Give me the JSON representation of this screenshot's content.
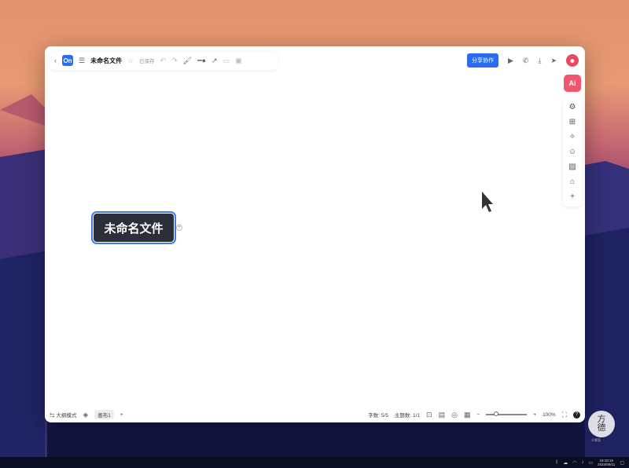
{
  "app": {
    "logo_text": "On",
    "doc_title": "未命名文件",
    "save_status": "已保存"
  },
  "toolbar": {
    "share_label": "分享协作"
  },
  "side_panel": {
    "ai_label": "Ai"
  },
  "canvas": {
    "root_node_text": "未命名文件",
    "add_child": "+"
  },
  "statusbar": {
    "outline_mode": "大纲模式",
    "layer_tab": "画布1",
    "add_layer": "+",
    "word_count_label": "字数:",
    "word_count": "5/5",
    "topic_count_label": "主题数:",
    "topic_count": "1/1",
    "zoom_out": "−",
    "zoom_in": "+",
    "zoom_level": "100%",
    "zoom_fraction": 0.25,
    "help": "?"
  },
  "watermark": {
    "line1": "方",
    "line2": "德",
    "sub": "半景版"
  },
  "taskbar": {
    "time": "18:18:16",
    "date": "2024/09/11"
  },
  "colors": {
    "accent": "#2a6df0",
    "node_bg": "#2c2f3a",
    "ai": "#f0566e"
  }
}
